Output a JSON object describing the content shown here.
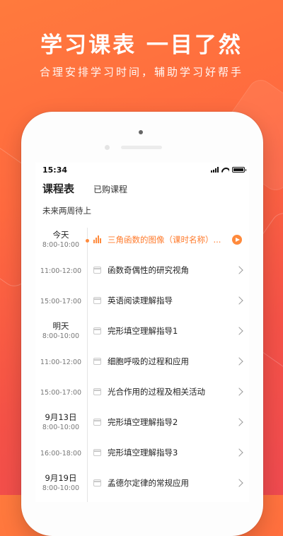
{
  "hero": {
    "title": "学习课表 一目了然",
    "subtitle": "合理安排学习时间，辅助学习好帮手"
  },
  "status_bar": {
    "time": "15:34"
  },
  "tabs": {
    "active": "课程表",
    "other": "已购课程"
  },
  "section_title": "未来两周待上",
  "schedule": [
    {
      "date": "今天",
      "time": "8:00-10:00",
      "title": "三角函数的图像（课时名称）...",
      "active": true
    },
    {
      "date": "",
      "time": "11:00-12:00",
      "title": "函数奇偶性的研究视角",
      "active": false
    },
    {
      "date": "",
      "time": "15:00-17:00",
      "title": "英语阅读理解指导",
      "active": false
    },
    {
      "date": "明天",
      "time": "8:00-10:00",
      "title": "完形填空理解指导1",
      "active": false
    },
    {
      "date": "",
      "time": "11:00-12:00",
      "title": "细胞呼吸的过程和应用",
      "active": false
    },
    {
      "date": "",
      "time": "15:00-17:00",
      "title": "光合作用的过程及相关活动",
      "active": false
    },
    {
      "date": "9月13日",
      "time": "8:00-10:00",
      "title": "完形填空理解指导2",
      "active": false
    },
    {
      "date": "",
      "time": "16:00-18:00",
      "title": "完形填空理解指导3",
      "active": false
    },
    {
      "date": "9月19日",
      "time": "8:00-10:00",
      "title": "孟德尔定律的常规应用",
      "active": false
    }
  ],
  "colors": {
    "accent": "#ff8a3c",
    "background_gradient_start": "#ff7a3d",
    "background_gradient_end": "#ef4a4f"
  }
}
